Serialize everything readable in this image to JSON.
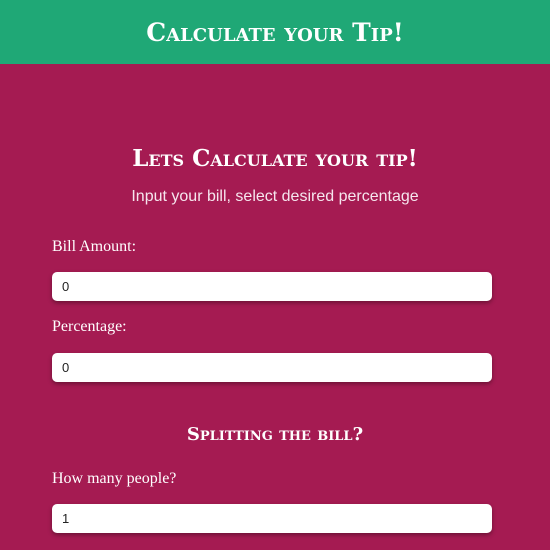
{
  "header": {
    "title": "Calculate your Tip!"
  },
  "calculator": {
    "title": "Lets Calculate your tip!",
    "subtitle": "Input your bill, select desired percentage",
    "bill": {
      "label": "Bill Amount:",
      "value": "0"
    },
    "percentage": {
      "label": "Percentage:",
      "value": "0"
    }
  },
  "split": {
    "title": "Splitting the bill?",
    "people": {
      "label": "How many people?",
      "value": "1"
    }
  },
  "colors": {
    "header_bg": "#1fa876",
    "page_bg": "#a51b52",
    "input_bg": "#ffffff"
  }
}
